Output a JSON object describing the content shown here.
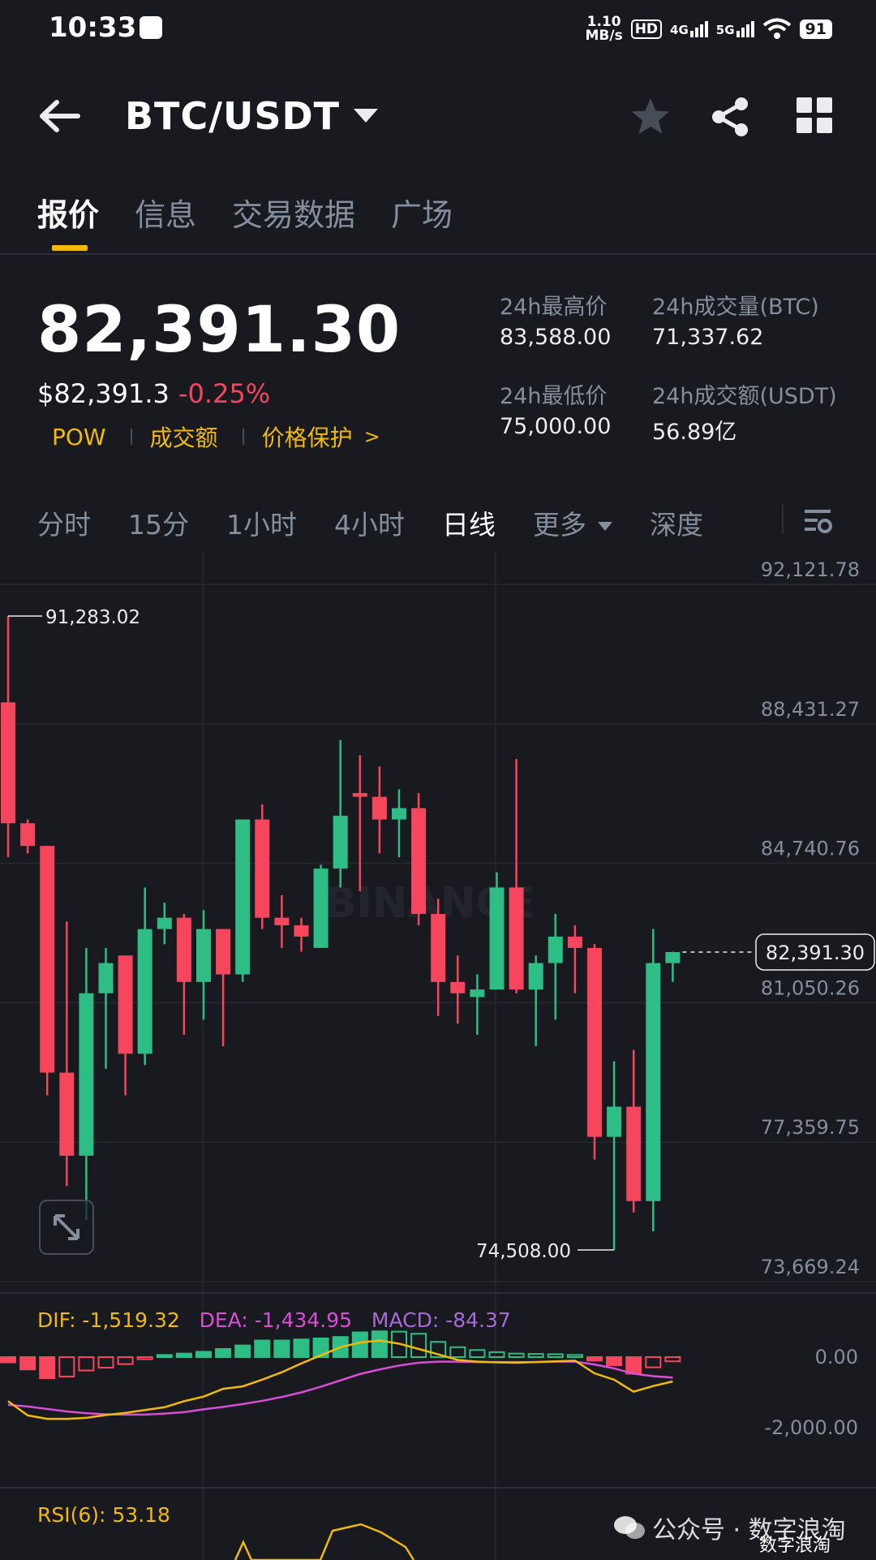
{
  "status_bar": {
    "time": "10:33",
    "net_speed_value": "1.10",
    "net_speed_unit": "MB/s",
    "hd_label": "HD",
    "sim_1": "4G",
    "sim_2": "5G",
    "battery": "91"
  },
  "header": {
    "pair": "BTC/USDT",
    "icons": [
      "back-arrow-icon",
      "chevron-down-icon",
      "star-icon",
      "share-icon",
      "grid-icon"
    ]
  },
  "tabs": [
    "报价",
    "信息",
    "交易数据",
    "广场"
  ],
  "active_tab": "报价",
  "price": {
    "last": "82,391.30",
    "usd": "$82,391.3",
    "change_pct": "-0.25%",
    "tags": [
      "POW",
      "成交额",
      "价格保护"
    ]
  },
  "stats": {
    "high_label": "24h最高价",
    "high_value": "83,588.00",
    "low_label": "24h最低价",
    "low_value": "75,000.00",
    "vol_btc_label": "24h成交量(BTC)",
    "vol_btc_value": "71,337.62",
    "vol_usdt_label": "24h成交额(USDT)",
    "vol_usdt_value": "56.89亿"
  },
  "intervals": [
    "分时",
    "15分",
    "1小时",
    "4小时",
    "日线",
    "更多"
  ],
  "active_interval": "日线",
  "depth_label": "深度",
  "chart_data": {
    "type": "candlestick",
    "price_axis_labels": [
      "92,121.78",
      "88,431.27",
      "84,740.76",
      "81,050.26",
      "77,359.75",
      "73,669.24"
    ],
    "ylim": [
      73669.24,
      92121.78
    ],
    "high_marker": "91,283.02",
    "low_marker": "74,508.00",
    "last_price_tag": "82,391.30",
    "candles": [
      {
        "o": 89000,
        "h": 91283.02,
        "l": 84900,
        "c": 85800
      },
      {
        "o": 85800,
        "h": 85900,
        "l": 85000,
        "c": 85200
      },
      {
        "o": 85200,
        "h": 85200,
        "l": 78600,
        "c": 79200
      },
      {
        "o": 79200,
        "h": 83200,
        "l": 76200,
        "c": 77000
      },
      {
        "o": 77000,
        "h": 82500,
        "l": 75300,
        "c": 81300
      },
      {
        "o": 81300,
        "h": 82500,
        "l": 79300,
        "c": 82100
      },
      {
        "o": 82300,
        "h": 82300,
        "l": 78600,
        "c": 79700
      },
      {
        "o": 79700,
        "h": 84100,
        "l": 79400,
        "c": 83000
      },
      {
        "o": 83000,
        "h": 83700,
        "l": 82600,
        "c": 83300
      },
      {
        "o": 83300,
        "h": 83400,
        "l": 80200,
        "c": 81600
      },
      {
        "o": 81600,
        "h": 83500,
        "l": 80600,
        "c": 83000
      },
      {
        "o": 83000,
        "h": 83000,
        "l": 79900,
        "c": 81800
      },
      {
        "o": 81800,
        "h": 85900,
        "l": 81600,
        "c": 85900
      },
      {
        "o": 85900,
        "h": 86300,
        "l": 83000,
        "c": 83300
      },
      {
        "o": 83300,
        "h": 83900,
        "l": 82500,
        "c": 83100
      },
      {
        "o": 83100,
        "h": 83300,
        "l": 82400,
        "c": 82800
      },
      {
        "o": 82500,
        "h": 84700,
        "l": 82500,
        "c": 84600
      },
      {
        "o": 84600,
        "h": 88000,
        "l": 84100,
        "c": 86000
      },
      {
        "o": 86600,
        "h": 87600,
        "l": 84000,
        "c": 86500
      },
      {
        "o": 86500,
        "h": 87300,
        "l": 85000,
        "c": 85900
      },
      {
        "o": 85900,
        "h": 86700,
        "l": 84900,
        "c": 86200
      },
      {
        "o": 86200,
        "h": 86600,
        "l": 83100,
        "c": 83400
      },
      {
        "o": 83400,
        "h": 83800,
        "l": 80700,
        "c": 81600
      },
      {
        "o": 81600,
        "h": 82300,
        "l": 80500,
        "c": 81300
      },
      {
        "o": 81200,
        "h": 81800,
        "l": 80200,
        "c": 81400
      },
      {
        "o": 81400,
        "h": 84500,
        "l": 81400,
        "c": 84100
      },
      {
        "o": 84100,
        "h": 87500,
        "l": 81300,
        "c": 81400
      },
      {
        "o": 81400,
        "h": 82300,
        "l": 79900,
        "c": 82100
      },
      {
        "o": 82100,
        "h": 83400,
        "l": 80600,
        "c": 82800
      },
      {
        "o": 82800,
        "h": 83100,
        "l": 81300,
        "c": 82500
      },
      {
        "o": 82500,
        "h": 82600,
        "l": 76900,
        "c": 77500
      },
      {
        "o": 77500,
        "h": 79500,
        "l": 74508,
        "c": 78300
      },
      {
        "o": 78300,
        "h": 79800,
        "l": 75500,
        "c": 75800
      },
      {
        "o": 75800,
        "h": 83000,
        "l": 75000,
        "c": 82100
      },
      {
        "o": 82100,
        "h": 82400,
        "l": 81600,
        "c": 82391.3
      }
    ]
  },
  "macd": {
    "dif_label": "DIF: -1,519.32",
    "dea_label": "DEA: -1,434.95",
    "macd_label": "MACD: -84.37",
    "axis_labels": [
      "0.00",
      "-2,000.00"
    ],
    "dif_color": "#f0b90b",
    "dea_color": "#d84fd6",
    "macd_label_color": "#a76ad6",
    "histogram": [
      -150,
      -350,
      -600,
      -550,
      -380,
      -300,
      -200,
      -60,
      60,
      100,
      150,
      230,
      330,
      470,
      470,
      500,
      530,
      570,
      700,
      730,
      720,
      660,
      430,
      280,
      200,
      140,
      100,
      90,
      80,
      60,
      -100,
      -230,
      -470,
      -290,
      -120
    ],
    "dif": [
      -1250,
      -1650,
      -1750,
      -1750,
      -1720,
      -1640,
      -1580,
      -1500,
      -1420,
      -1250,
      -1120,
      -900,
      -830,
      -640,
      -430,
      -180,
      50,
      280,
      410,
      470,
      380,
      230,
      80,
      -80,
      -130,
      -150,
      -160,
      -140,
      -120,
      -100,
      -460,
      -640,
      -980,
      -820,
      -690
    ],
    "dea": [
      -1350,
      -1400,
      -1470,
      -1540,
      -1590,
      -1620,
      -1630,
      -1630,
      -1600,
      -1560,
      -1480,
      -1410,
      -1330,
      -1240,
      -1130,
      -1000,
      -840,
      -660,
      -480,
      -350,
      -240,
      -160,
      -130,
      -130,
      -140,
      -140,
      -140,
      -140,
      -130,
      -130,
      -210,
      -320,
      -470,
      -540,
      -580
    ]
  },
  "rsi": {
    "label": "RSI(6): 53.18",
    "color": "#f0b90b"
  },
  "watermark": {
    "text": "公众号 · 数字浪淘",
    "corner": "数字浪淘"
  },
  "colors": {
    "up": "#2ebd85",
    "down": "#f6465d",
    "accent": "#f0b90b",
    "background": "#181a20"
  }
}
